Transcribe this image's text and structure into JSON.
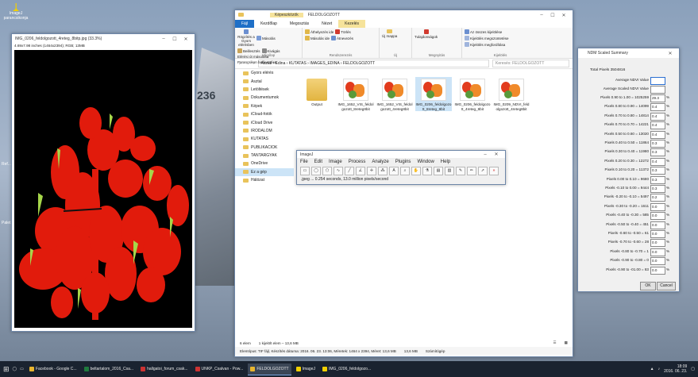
{
  "desktop": {
    "icon_label": "ImageJ parancsikonja",
    "plane_text": "236",
    "left_label_1": "Ref...",
    "left_label_2": "Palet..."
  },
  "image_window": {
    "title": "IMG_0206_feldolgozott_4reteg_8bitp.jpg (33.3%)",
    "info": "4.69x7.98 inches (1464x2394); RGB; 13MB",
    "colors": {
      "background": "#000000",
      "plant": "#e11b0c",
      "highlight": "#a6d64a"
    }
  },
  "explorer": {
    "title": "FELDOLGOZOTT",
    "context_tab": "Képeszközök",
    "tabs": [
      "Fájl",
      "Kezdőlap",
      "Megosztás",
      "Nézet",
      "Kezelés"
    ],
    "ribbon_groups": [
      {
        "label": "Vágólap",
        "items": [
          "Rögzítés a Gyors elérésben",
          "Másolás",
          "Beillesztés",
          "Kivágás",
          "Elérési út másolása",
          "Parancsikon beillesztése"
        ]
      },
      {
        "label": "Rendszerezés",
        "items": [
          "Áthelyezés ide",
          "Másolás ide",
          "Törlés",
          "Átnevezés"
        ]
      },
      {
        "label": "Új",
        "items": [
          "Új mappa"
        ]
      },
      {
        "label": "Megnyitás",
        "items": [
          "Tulajdonságok"
        ]
      },
      {
        "label": "Kijelölés",
        "items": [
          "Az összes kijelölése",
          "Kijelölés megszüntetése",
          "Kijelölés megfordítása"
        ]
      }
    ],
    "address": [
      "Asztal",
      "Edina",
      "KUTATAS",
      "IMAGES_EDINA",
      "FELDOLGOZOTT"
    ],
    "search_placeholder": "Keresés: FELDOLGOZOTT",
    "nav": [
      {
        "label": "Gyors elérés",
        "selected": false
      },
      {
        "label": "Asztal",
        "selected": false
      },
      {
        "label": "Letöltések",
        "selected": false
      },
      {
        "label": "Dokumentumok",
        "selected": false
      },
      {
        "label": "Képek",
        "selected": false
      },
      {
        "label": "iCloud-fotók",
        "selected": false
      },
      {
        "label": "iCloud Drive",
        "selected": false
      },
      {
        "label": "IRODALOM",
        "selected": false
      },
      {
        "label": "KUTATAS",
        "selected": false
      },
      {
        "label": "PUBLIKACIOK",
        "selected": false
      },
      {
        "label": "TANTARGYAK",
        "selected": false
      },
      {
        "label": "OneDrive",
        "selected": false
      },
      {
        "label": "Ez a gép",
        "selected": true
      },
      {
        "label": "Hálózat",
        "selected": false
      }
    ],
    "files": [
      {
        "name": "Output",
        "kind": "folder",
        "selected": false
      },
      {
        "name": "IMG_1652_VIS_feldolgozott_8reteg8bit",
        "kind": "image",
        "selected": false
      },
      {
        "name": "IMG_1652_VIS_feldolgozott_4reteg8bit",
        "kind": "image",
        "selected": false
      },
      {
        "name": "IMG_0206_feldolgozott_8reteg_8bit",
        "kind": "image",
        "selected": true
      },
      {
        "name": "IMG_0206_feldolgozott_4reteg_8bit",
        "kind": "image",
        "selected": false
      },
      {
        "name": "IMG_0209_NDVI_feldolgozott_4reteg8bit",
        "kind": "image",
        "selected": false
      }
    ],
    "status_count": "6 elem",
    "status_selected": "1 kijelölt elem – 13,6 MB",
    "details": "Elemtípus: TIF fájl, Készítés dátuma: 2016. 06. 23. 13:06, Méretek: 1464 x 2394, Méret: 13,6 MB",
    "details_size": "13,6 MB",
    "details_location": "Számítógép"
  },
  "imagej": {
    "title": "ImageJ",
    "menu": [
      "File",
      "Edit",
      "Image",
      "Process",
      "Analyze",
      "Plugins",
      "Window",
      "Help"
    ],
    "status": ".jpeg ... 0.254 seconds, 13.0 million pixels/second"
  },
  "ndvi": {
    "title": "NDM Scaled Summary",
    "total": "Total Pixels 3504816",
    "average_label": "Average NDVI Value",
    "average_scaled_label": "Average Scaled NDVI Value",
    "rows": [
      {
        "label": "Pixels 0.90 to 1.00 = 1025259",
        "value": "29.3"
      },
      {
        "label": "Pixels 0.80 to 0.90 = 14099",
        "value": "0.4"
      },
      {
        "label": "Pixels 0.70 to 0.80 = 14814",
        "value": "0.4"
      },
      {
        "label": "Pixels 0.70 to 0.70 = 14221",
        "value": "0.4"
      },
      {
        "label": "Pixels 0.50 to 0.60 = 13020",
        "value": "0.4"
      },
      {
        "label": "Pixels 0.40 to 0.50 = 11864",
        "value": "0.3"
      },
      {
        "label": "Pixels 0.30 to 0.40 = 11980",
        "value": "0.3"
      },
      {
        "label": "Pixels 0.20 to 0.30 = 12272",
        "value": "0.4"
      },
      {
        "label": "Pixels 0.10 to 0.20 = 11372",
        "value": "0.3"
      },
      {
        "label": "Pixels 0.00 to 0.10 = 9680",
        "value": "0.3"
      },
      {
        "label": "Pixels -0.10 to 0.00 = 9444",
        "value": "0.3"
      },
      {
        "label": "Pixels -0.20 to -0.10 = 5497",
        "value": "0.2"
      },
      {
        "label": "Pixels -0.30 to -0.20 = 1611",
        "value": "0.0"
      },
      {
        "label": "Pixels -0.40 to -0.30 = 585",
        "value": "0.0"
      },
      {
        "label": "Pixels -0.50 to -0.40 = 451",
        "value": "0.0"
      },
      {
        "label": "Pixels -0.60 to -0.50 = 61",
        "value": "0.0"
      },
      {
        "label": "Pixels -0.70 to -0.60 = 28",
        "value": "0.0"
      },
      {
        "label": "Pixels -0.80 to -0.70 = 1",
        "value": "0.0"
      },
      {
        "label": "Pixels -0.90 to -0.80 = 0",
        "value": "0.0"
      },
      {
        "label": "Pixels -0.90 to -01.00 = 83",
        "value": "0.0"
      }
    ],
    "ok": "OK",
    "cancel": "Cancel"
  },
  "taskbar": {
    "items": [
      {
        "label": "Facebook - Google C...",
        "active": false
      },
      {
        "label": "beltartalom_2016_Csa...",
        "active": false
      },
      {
        "label": "hallgatoi_forum_csak...",
        "active": false
      },
      {
        "label": "UNKP_Csalvan - Pow...",
        "active": false
      },
      {
        "label": "FELDOLGOZOTT",
        "active": true
      },
      {
        "label": "ImageJ",
        "active": false
      },
      {
        "label": "IMG_0206_feldolgozo...",
        "active": false
      }
    ],
    "time": "18:09",
    "date": "2016. 06. 23."
  }
}
